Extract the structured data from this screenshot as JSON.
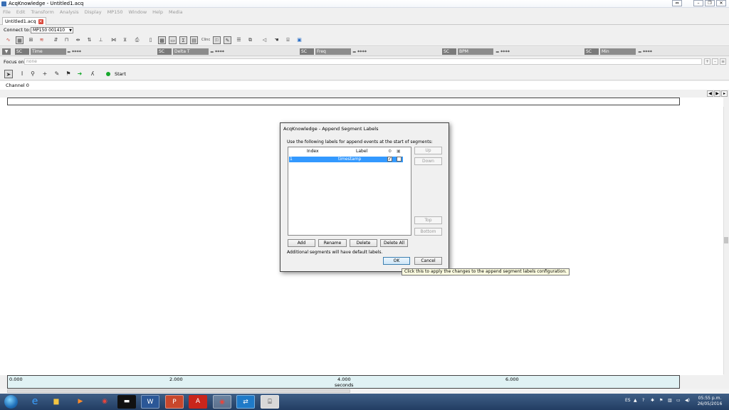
{
  "window": {
    "title": "AcqKnowledge - Untitled1.acq"
  },
  "menu": [
    "File",
    "Edit",
    "Transform",
    "Analysis",
    "Display",
    "MP150",
    "Window",
    "Help",
    "Media"
  ],
  "tab": {
    "label": "Untitled1.acq"
  },
  "connect": {
    "label": "Connect to:",
    "value": "MP150 001410"
  },
  "measurements": [
    {
      "channel": "SC",
      "name": "Time",
      "value": "****"
    },
    {
      "channel": "SC",
      "name": "Delta T",
      "value": "****"
    },
    {
      "channel": "SC",
      "name": "Freq",
      "value": "****"
    },
    {
      "channel": "SC",
      "name": "BPM",
      "value": "****"
    },
    {
      "channel": "SC",
      "name": "Min",
      "value": "****"
    }
  ],
  "measure_eq": "=",
  "focus": {
    "label": "Focus on:",
    "value": "none"
  },
  "start": {
    "label": "Start"
  },
  "channel": {
    "label": "Channel 0"
  },
  "timeline": {
    "ticks": [
      "0.000",
      "2.000",
      "4.000",
      "6.000"
    ],
    "unit": "seconds"
  },
  "dialog": {
    "title": "AcqKnowledge - Append Segment Labels",
    "description": "Use the following labels for append events at the start of segments:",
    "columns": {
      "index": "Index",
      "label": "Label"
    },
    "rows": [
      {
        "index": "1",
        "label": "timestamp",
        "checked1": true,
        "checked2": false
      }
    ],
    "side_buttons": {
      "up": "Up",
      "down": "Down",
      "top": "Top",
      "bottom": "Bottom"
    },
    "buttons": {
      "add": "Add",
      "rename": "Rename",
      "delete": "Delete",
      "delete_all": "Delete All",
      "ok": "OK",
      "cancel": "Cancel"
    },
    "footer": "Additional segments will have default labels."
  },
  "tooltip": "Click this to apply the changes to the append segment labels configuration.",
  "taskbar": {
    "lang": "ES",
    "time": "05:55 p.m.",
    "date": "26/05/2016"
  }
}
